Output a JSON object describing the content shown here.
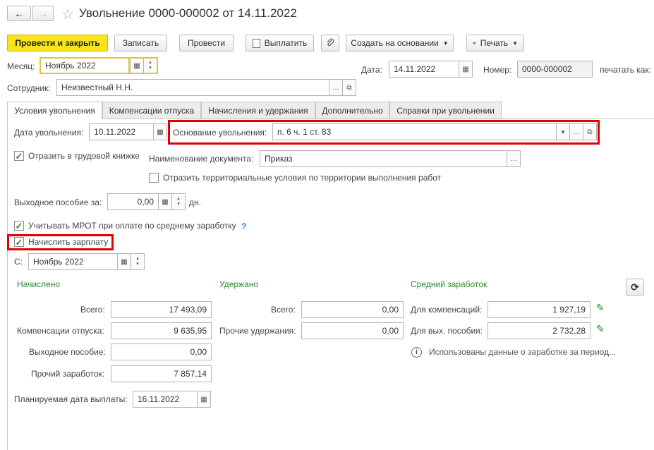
{
  "window": {
    "title": "Увольнение 0000-000002 от 14.11.2022",
    "back_icon": "←",
    "forward_icon": "→",
    "star_icon": "☆"
  },
  "toolbar": {
    "post_close": "Провести и закрыть",
    "save": "Записать",
    "post": "Провести",
    "pay": "Выплатить",
    "create_based": "Создать на основании",
    "print": "Печать"
  },
  "header": {
    "month_label": "Месяц:",
    "month_value": "Ноябрь 2022",
    "date_label": "Дата:",
    "date_value": "14.11.2022",
    "number_label": "Номер:",
    "number_value": "0000-000002",
    "print_as_label": "печатать как:",
    "employee_label": "Сотрудник:",
    "employee_value": "Неизвестный Н.Н."
  },
  "tabs": [
    {
      "label": "Условия увольнения"
    },
    {
      "label": "Компенсации отпуска"
    },
    {
      "label": "Начисления и удержания"
    },
    {
      "label": "Дополнительно"
    },
    {
      "label": "Справки при увольнении"
    }
  ],
  "conditions": {
    "dismissal_date_label": "Дата увольнения:",
    "dismissal_date": "10.11.2022",
    "basis_label": "Основание увольнения:",
    "basis_value": "п. 6 ч. 1 ст. 83",
    "reflect_book_label": "Отразить в трудовой книжке",
    "doc_name_label": "Наименование документа:",
    "doc_name_value": "Приказ",
    "territorial_label": "Отразить территориальные условия по территории выполнения работ",
    "severance_label": "Выходное пособие за:",
    "severance_value": "0,00",
    "days_label": "дн.",
    "mrot_label": "Учитывать МРОТ при оплате по среднему заработку",
    "help_icon": "?",
    "accrue_salary_label": "Начислить зарплату",
    "from_label": "С:",
    "from_value": "Ноябрь 2022"
  },
  "accrued": {
    "title": "Начислено",
    "total_label": "Всего:",
    "total": "17 493,09",
    "vacation_label": "Компенсации отпуска:",
    "vacation": "9 635,95",
    "severance_label": "Выходное пособие:",
    "severance": "0,00",
    "other_label": "Прочий заработок:",
    "other": "7 857,14"
  },
  "withheld": {
    "title": "Удержано",
    "total_label": "Всего:",
    "total": "0,00",
    "other_label": "Прочие удержания:",
    "other": "0,00"
  },
  "average": {
    "title": "Средний заработок",
    "comp_label": "Для компенсаций:",
    "comp": "1 927,19",
    "sev_label": "Для вых. пособия:",
    "sev": "2 732,28",
    "info_text": "Использованы данные о заработке за период..."
  },
  "payout": {
    "label": "Планируемая дата выплаты:",
    "value": "16.11.2022"
  },
  "colors": {
    "accent_yellow": "#f8e31c",
    "highlight_red": "#e30000",
    "section_green": "#2c8a2c"
  }
}
